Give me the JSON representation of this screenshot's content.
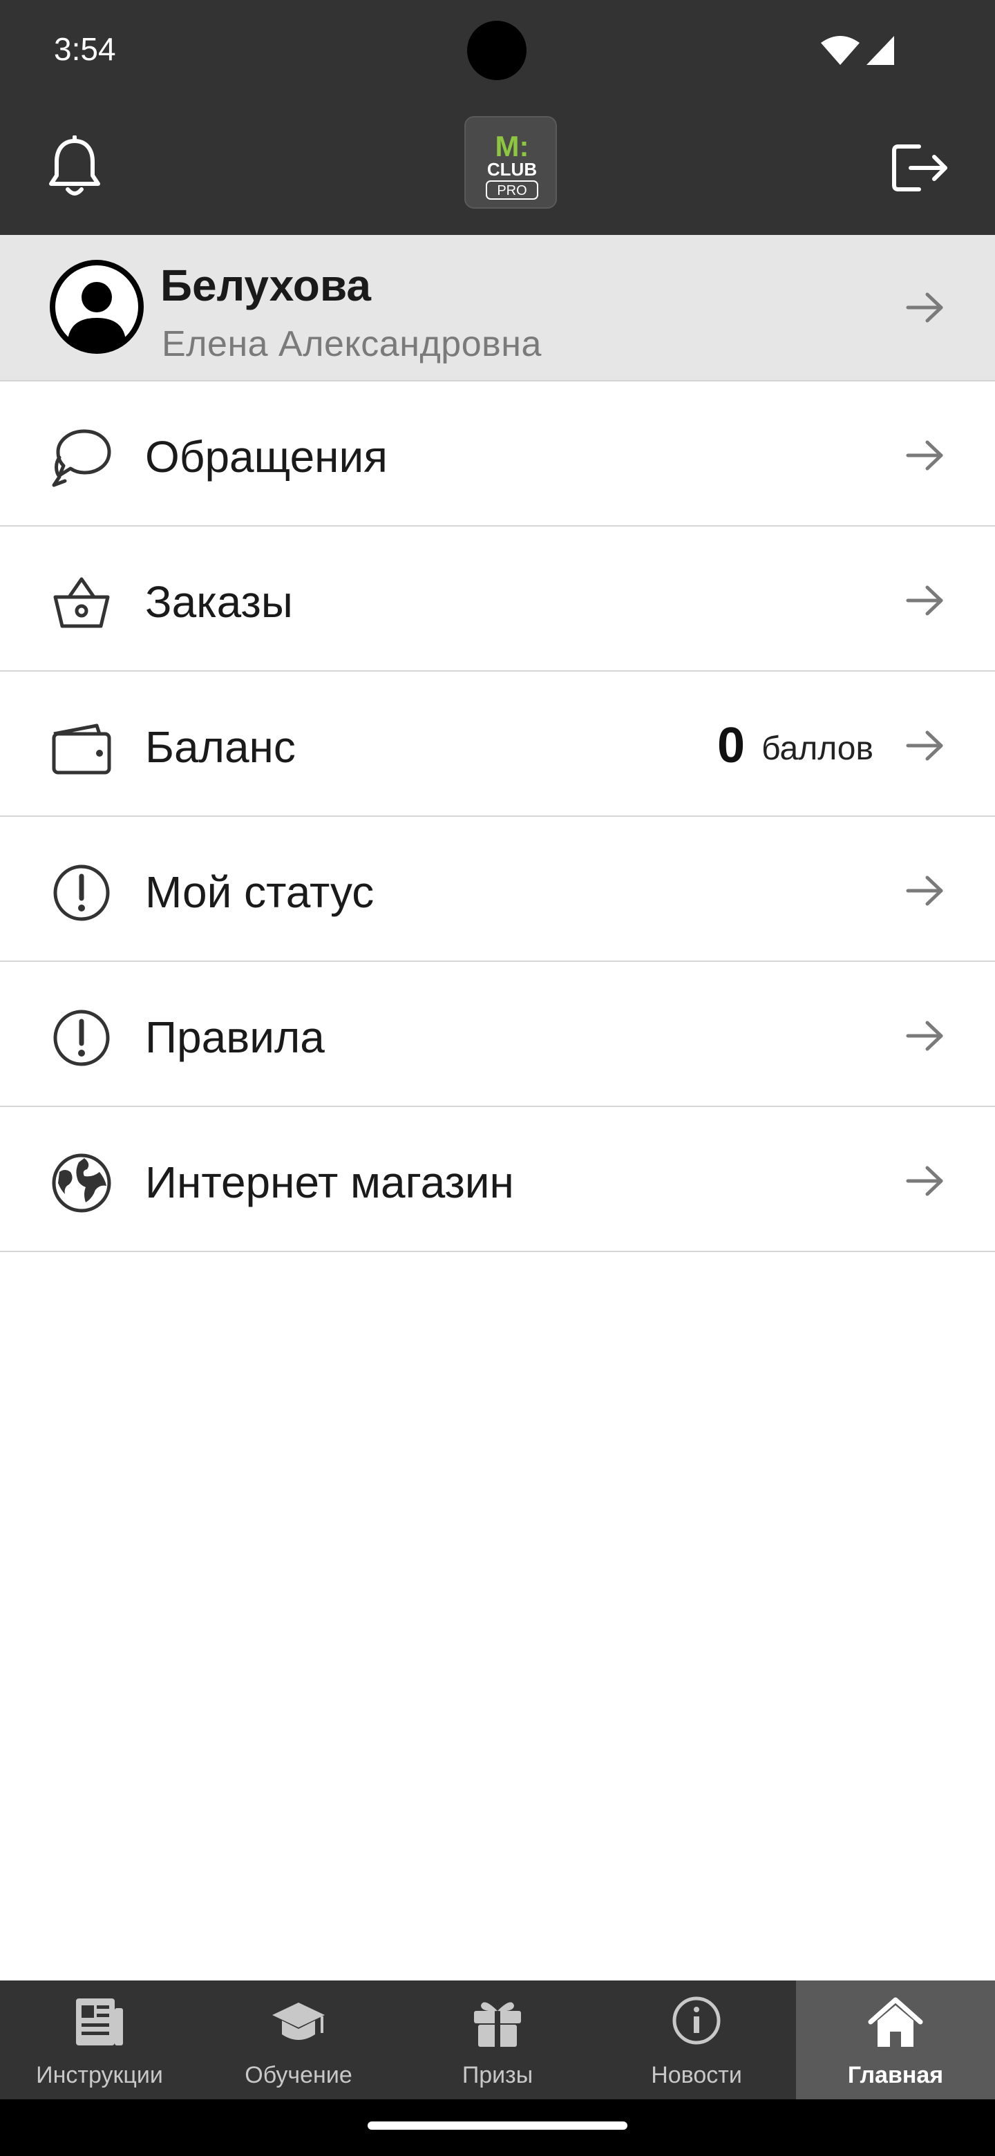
{
  "status_bar": {
    "time": "3:54"
  },
  "header": {
    "logo_text": {
      "top": "M:",
      "middle": "CLUB",
      "bottom": "PRO"
    }
  },
  "profile": {
    "last_name": "Белухова",
    "first_middle_name": "Елена Александровна"
  },
  "menu": {
    "items": [
      {
        "label": "Обращения",
        "icon": "chat-bubble-icon"
      },
      {
        "label": "Заказы",
        "icon": "basket-icon"
      },
      {
        "label": "Баланс",
        "icon": "wallet-icon",
        "value": "0",
        "unit": "баллов"
      },
      {
        "label": "Мой статус",
        "icon": "exclamation-circle-icon"
      },
      {
        "label": "Правила",
        "icon": "exclamation-circle-icon"
      },
      {
        "label": "Интернет магазин",
        "icon": "globe-icon"
      }
    ]
  },
  "bottom_nav": {
    "items": [
      {
        "label": "Инструкции",
        "icon": "newspaper-icon"
      },
      {
        "label": "Обучение",
        "icon": "graduation-cap-icon"
      },
      {
        "label": "Призы",
        "icon": "gift-icon"
      },
      {
        "label": "Новости",
        "icon": "info-circle-icon"
      },
      {
        "label": "Главная",
        "icon": "home-icon",
        "active": true
      }
    ]
  },
  "colors": {
    "header_bg": "#333333",
    "profile_bg": "#e6e6e6",
    "logo_green": "#8dc63f",
    "nav_active_bg": "#5a5a5a"
  }
}
